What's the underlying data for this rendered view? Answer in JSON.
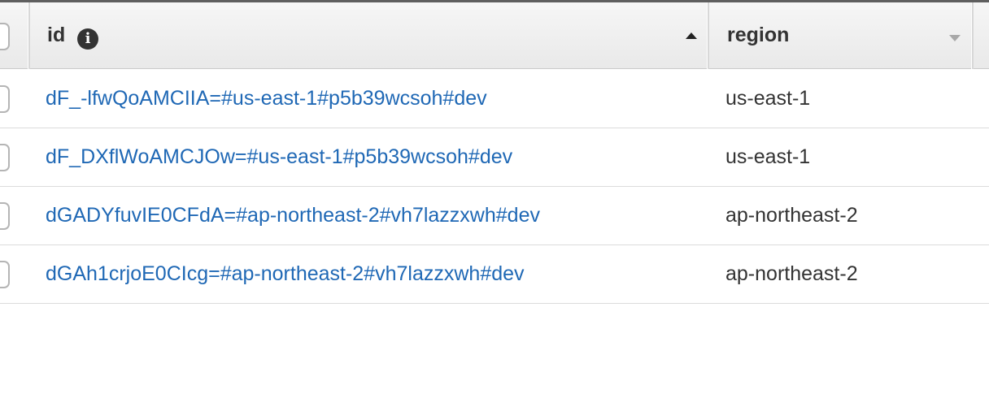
{
  "table": {
    "columns": [
      {
        "label": "id",
        "sort": "ascending"
      },
      {
        "label": "region",
        "sort": "none"
      }
    ],
    "rows": [
      {
        "id": "dF_-lfwQoAMCIIA=#us-east-1#p5b39wcsoh#dev",
        "region": "us-east-1"
      },
      {
        "id": "dF_DXflWoAMCJOw=#us-east-1#p5b39wcsoh#dev",
        "region": "us-east-1"
      },
      {
        "id": "dGADYfuvIE0CFdA=#ap-northeast-2#vh7lazzxwh#dev",
        "region": "ap-northeast-2"
      },
      {
        "id": "dGAh1crjoE0CIcg=#ap-northeast-2#vh7lazzxwh#dev",
        "region": "ap-northeast-2"
      }
    ]
  },
  "icons": {
    "info": "info-icon",
    "sort_ascending": "sort-ascending-icon",
    "sort_descending": "sort-descending-icon"
  },
  "colors": {
    "link": "#1f68b5",
    "text": "#333333",
    "header_bg": "#eeeeee"
  }
}
